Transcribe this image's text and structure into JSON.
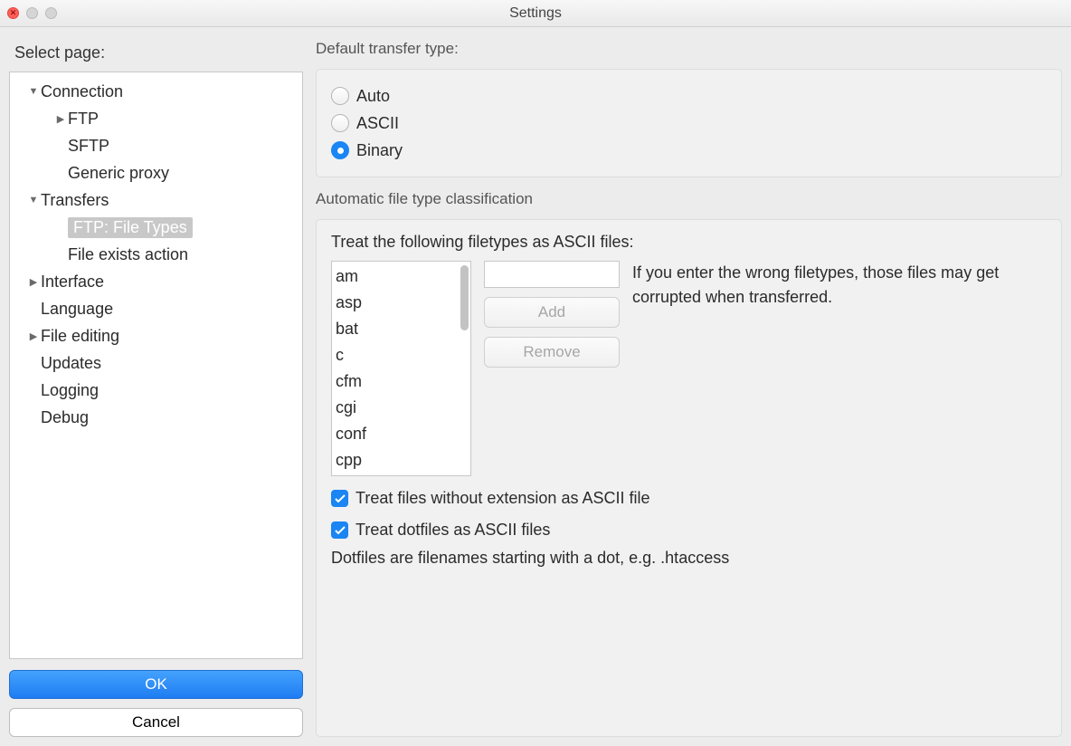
{
  "window": {
    "title": "Settings"
  },
  "sidebar": {
    "label": "Select page:",
    "items": [
      {
        "label": "Connection",
        "depth": 0,
        "expanded": true
      },
      {
        "label": "FTP",
        "depth": 1,
        "hasChildren": true
      },
      {
        "label": "SFTP",
        "depth": 1
      },
      {
        "label": "Generic proxy",
        "depth": 1
      },
      {
        "label": "Transfers",
        "depth": 0,
        "expanded": true
      },
      {
        "label": "FTP: File Types",
        "depth": 1,
        "selected": true
      },
      {
        "label": "File exists action",
        "depth": 1
      },
      {
        "label": "Interface",
        "depth": 0,
        "hasChildren": true
      },
      {
        "label": "Language",
        "depth": 0
      },
      {
        "label": "File editing",
        "depth": 0,
        "hasChildren": true
      },
      {
        "label": "Updates",
        "depth": 0
      },
      {
        "label": "Logging",
        "depth": 0
      },
      {
        "label": "Debug",
        "depth": 0
      }
    ],
    "ok": "OK",
    "cancel": "Cancel"
  },
  "transfer": {
    "groupLabel": "Default transfer type:",
    "options": {
      "auto": "Auto",
      "ascii": "ASCII",
      "binary": "Binary"
    },
    "selected": "binary"
  },
  "classification": {
    "groupLabel": "Automatic file type classification",
    "treatLabel": "Treat the following filetypes as ASCII files:",
    "list": [
      "am",
      "asp",
      "bat",
      "c",
      "cfm",
      "cgi",
      "conf",
      "cpp"
    ],
    "newValue": "",
    "addLabel": "Add",
    "removeLabel": "Remove",
    "hint": "If you enter the wrong filetypes, those files may get corrupted when transferred.",
    "chk1": "Treat files without extension as ASCII file",
    "chk2": "Treat dotfiles as ASCII files",
    "chk1Checked": true,
    "chk2Checked": true,
    "dotnote": "Dotfiles are filenames starting with a dot, e.g. .htaccess"
  }
}
